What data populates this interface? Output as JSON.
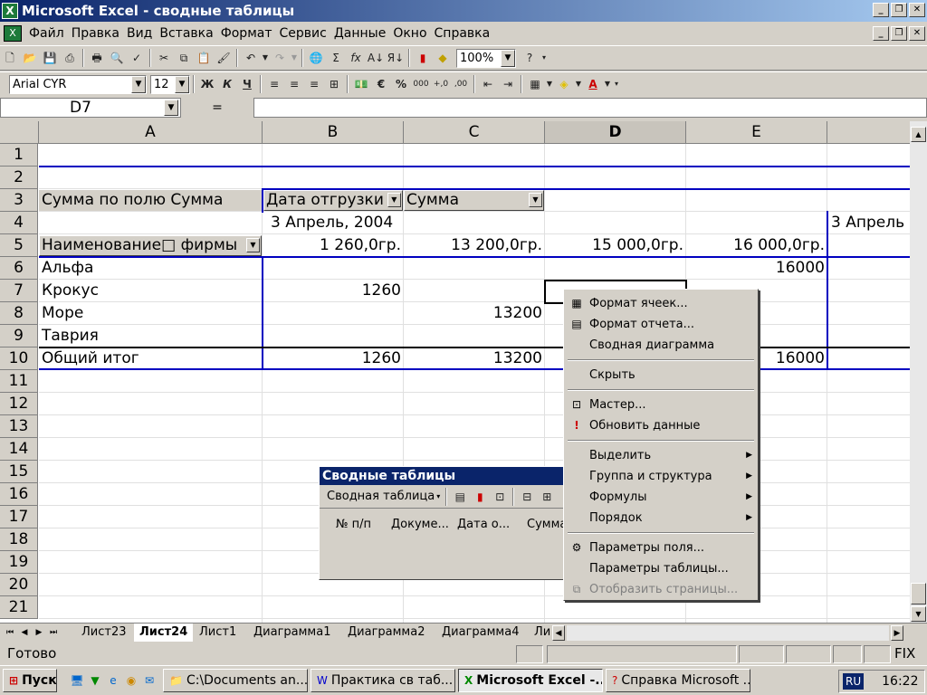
{
  "window": {
    "title": "Microsoft Excel - сводные таблицы"
  },
  "menu": [
    "Файл",
    "Правка",
    "Вид",
    "Вставка",
    "Формат",
    "Сервис",
    "Данные",
    "Окно",
    "Справка"
  ],
  "toolbar": {
    "zoom": "100%",
    "font": "Arial CYR",
    "size": "12"
  },
  "formula": {
    "namebox": "D7",
    "eq": "=",
    "value": ""
  },
  "columns": [
    "A",
    "B",
    "C",
    "D",
    "E"
  ],
  "rows": [
    "1",
    "2",
    "3",
    "4",
    "5",
    "6",
    "7",
    "8",
    "9",
    "10",
    "11",
    "12",
    "13",
    "14",
    "15",
    "16",
    "17",
    "18",
    "19",
    "20",
    "21"
  ],
  "cells": {
    "a3": "Сумма по полю Сумма",
    "b3": "Дата отгрузки",
    "c3": "Сумма",
    "b4": "3 Апрель, 2004",
    "f4": "3 Апрель",
    "a5": "Наименование□ фирмы",
    "b5": "1 260,0гр.",
    "c5": "13 200,0гр.",
    "d5": "15 000,0гр.",
    "e5": "16 000,0гр.",
    "a6": "Альфа",
    "e6": "16000",
    "a7": "Крокус",
    "b7": "1260",
    "a8": "Море",
    "c8": "13200",
    "a9": "Таврия",
    "a10": "Общий итог",
    "b10": "1260",
    "c10": "13200",
    "e10": "16000"
  },
  "sheets": [
    "Лист23",
    "Лист24",
    "Лист1",
    "Диаграмма1",
    "Диаграмма2",
    "Диаграмма4",
    "Ли"
  ],
  "active_sheet": "Лист24",
  "status": {
    "ready": "Готово",
    "fix": "FIX"
  },
  "pivot_toolbar": {
    "title": "Сводные таблицы",
    "menu": "Сводная таблица",
    "fields": [
      "№ п/п",
      "Докуме...",
      "Дата о...",
      "Сумма"
    ]
  },
  "context_menu": [
    {
      "label": "Формат ячеек...",
      "icon": "format-cells-icon"
    },
    {
      "label": "Формат отчета...",
      "icon": "format-report-icon"
    },
    {
      "label": "Сводная диаграмма",
      "icon": ""
    },
    {
      "sep": true
    },
    {
      "label": "Скрыть",
      "icon": ""
    },
    {
      "sep": true
    },
    {
      "label": "Мастер...",
      "icon": "wizard-icon"
    },
    {
      "label": "Обновить данные",
      "icon": "refresh-icon"
    },
    {
      "sep": true
    },
    {
      "label": "Выделить",
      "sub": true
    },
    {
      "label": "Группа и структура",
      "sub": true
    },
    {
      "label": "Формулы",
      "sub": true
    },
    {
      "label": "Порядок",
      "sub": true
    },
    {
      "sep": true
    },
    {
      "label": "Параметры поля...",
      "icon": "field-settings-icon"
    },
    {
      "label": "Параметры таблицы...",
      "icon": ""
    },
    {
      "label": "Отобразить страницы...",
      "icon": "pages-icon",
      "disabled": true
    }
  ],
  "taskbar": {
    "start": "Пуск",
    "items": [
      "C:\\Documents an...",
      "Практика  св таб...",
      "Microsoft Excel -...",
      "Справка Microsoft ..."
    ],
    "lang": "RU",
    "time": "16:22"
  }
}
